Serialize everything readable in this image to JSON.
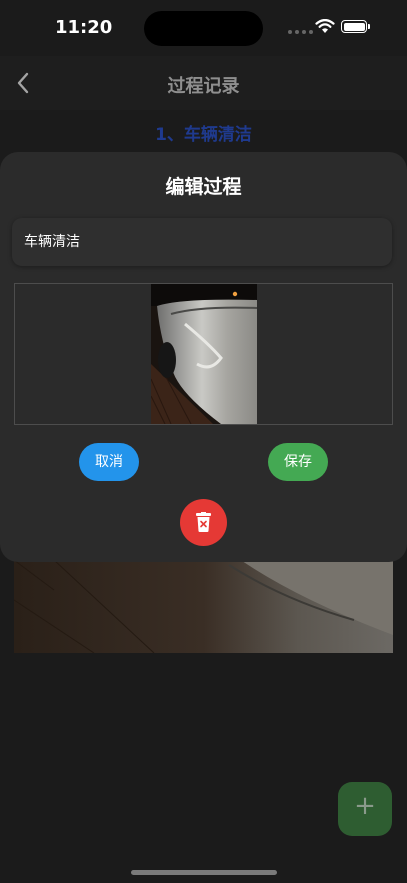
{
  "status": {
    "time": "11:20"
  },
  "nav": {
    "title": "过程记录",
    "back_icon": "chevron-left-icon"
  },
  "background": {
    "section_title": "1、车辆清洁"
  },
  "dialog": {
    "title": "编辑过程",
    "name_value": "车辆清洁",
    "cancel_label": "取消",
    "save_label": "保存",
    "delete_icon": "trash-icon"
  },
  "fab": {
    "icon": "plus-icon",
    "label": "+"
  },
  "colors": {
    "cancel": "#2394eb",
    "save": "#44a953",
    "delete": "#e53935",
    "fab": "#2e5d31",
    "section_title": "#1f3a8e"
  }
}
